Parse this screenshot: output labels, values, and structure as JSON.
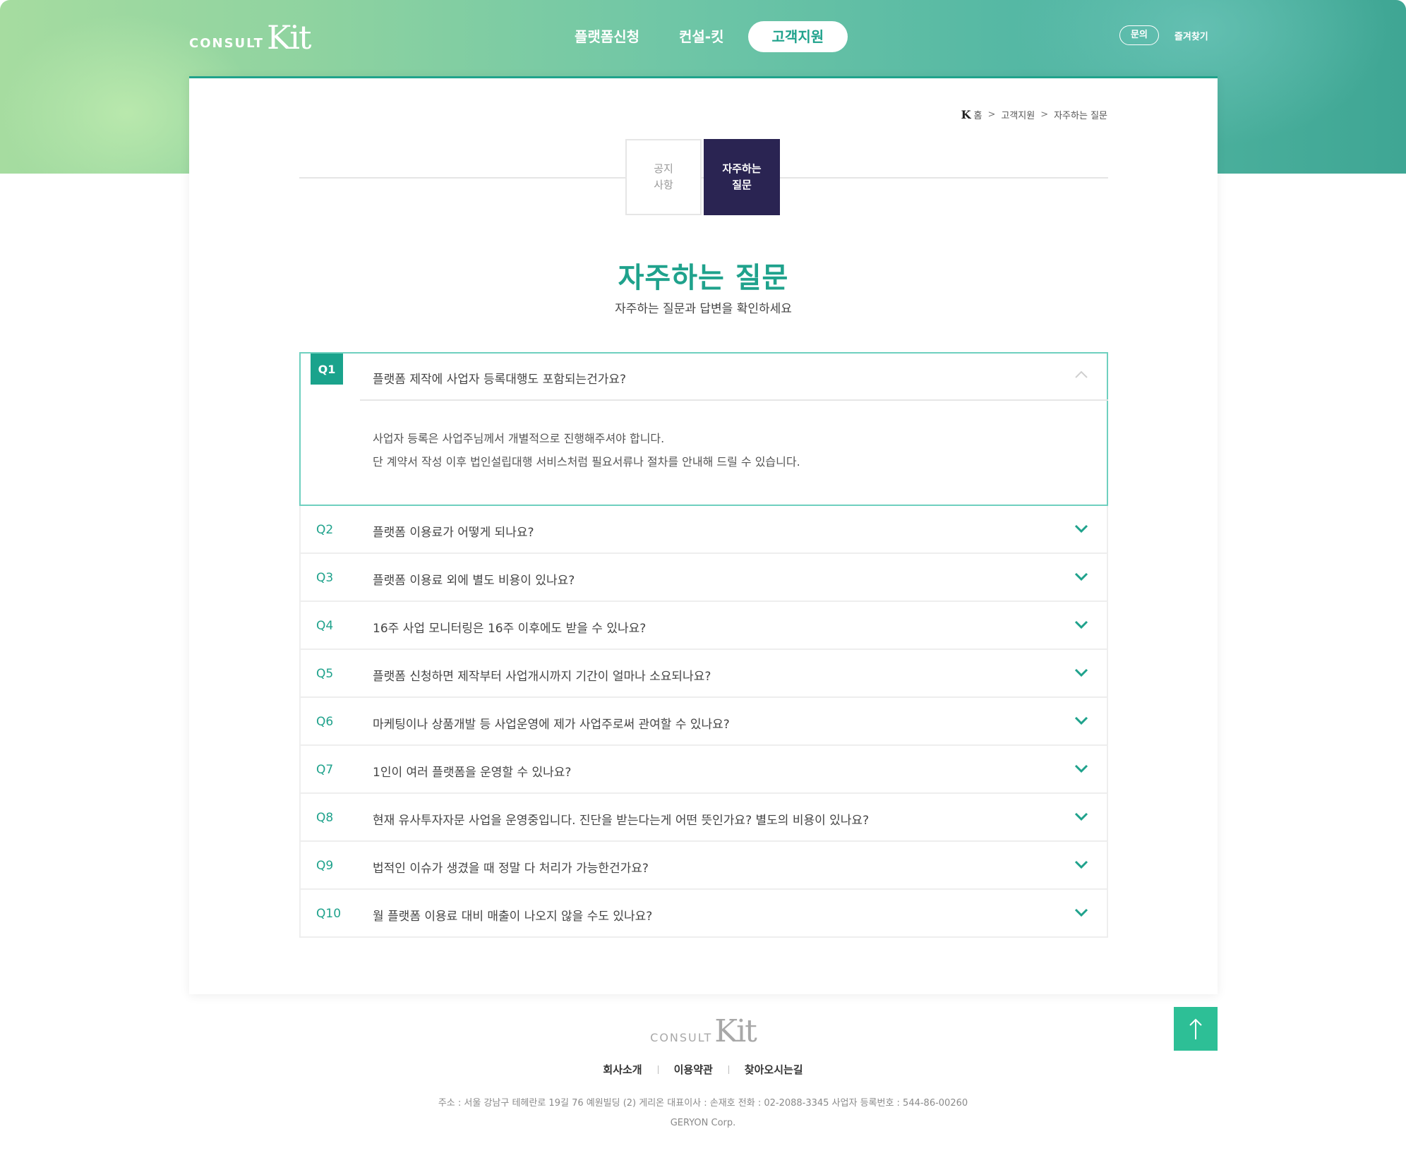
{
  "header": {
    "logo": {
      "consult": "CONSULT",
      "kit": "Kit"
    },
    "nav": [
      {
        "label": "플랫폼신청"
      },
      {
        "label": "컨설-킷"
      },
      {
        "label": "고객지원"
      }
    ],
    "util": {
      "inquiry": "문의",
      "favorites": "즐겨찾기"
    }
  },
  "breadcrumb": {
    "mark": "K",
    "items": [
      "홈",
      "고객지원",
      "자주하는 질문"
    ],
    "separator": ">"
  },
  "tabs": [
    {
      "label": "공지\n사항",
      "active": false
    },
    {
      "label": "자주하는\n질문",
      "active": true
    }
  ],
  "page": {
    "title": "자주하는 질문",
    "subtitle": "자주하는 질문과 답변을 확인하세요"
  },
  "faq": [
    {
      "num": "Q1",
      "question": "플랫폼 제작에 사업자 등록대행도 포함되는건가요?",
      "open": true,
      "answer": [
        "사업자 등록은 사업주님께서 개별적으로 진행해주셔야 합니다.",
        "단 계약서 작성 이후 법인설립대행 서비스처럼 필요서류나 절차를 안내해 드릴 수 있습니다."
      ]
    },
    {
      "num": "Q2",
      "question": "플랫폼 이용료가 어떻게 되나요?",
      "open": false
    },
    {
      "num": "Q3",
      "question": "플랫폼 이용료 외에 별도 비용이 있나요?",
      "open": false
    },
    {
      "num": "Q4",
      "question": "16주 사업 모니터링은 16주 이후에도 받을 수 있나요?",
      "open": false
    },
    {
      "num": "Q5",
      "question": "플랫폼 신청하면 제작부터 사업개시까지 기간이 얼마나 소요되나요?",
      "open": false
    },
    {
      "num": "Q6",
      "question": "마케팅이나 상품개발 등 사업운영에 제가 사업주로써 관여할 수 있나요?",
      "open": false
    },
    {
      "num": "Q7",
      "question": "1인이 여러 플랫폼을 운영할 수 있나요?",
      "open": false
    },
    {
      "num": "Q8",
      "question": "현재 유사투자자문 사업을 운영중입니다. 진단을 받는다는게 어떤 뜻인가요? 별도의 비용이 있나요?",
      "open": false
    },
    {
      "num": "Q9",
      "question": "법적인 이슈가 생겼을 때 정말 다 처리가 가능한건가요?",
      "open": false
    },
    {
      "num": "Q10",
      "question": "월 플랫폼 이용료 대비 매출이 나오지 않을 수도 있나요?",
      "open": false
    }
  ],
  "footer": {
    "logo": {
      "consult": "CONSULT",
      "kit": "Kit"
    },
    "links": [
      "회사소개",
      "이용약관",
      "찾아오시는길"
    ],
    "info": "주소 : 서울 강남구 테헤란로 19길 76 예원빌딩 (2) 게리온    대표이사 : 손재호    전화 : 02-2088-3345    사업자 등록번호 : 544-86-00260",
    "corp": "GERYON Corp."
  },
  "colors": {
    "accent": "#1fa28c",
    "tab_active_bg": "#2a2452",
    "top_button": "#2dbf96",
    "open_border": "#6fd0bf"
  },
  "icons": {
    "chevron_down": "chevron-down-icon",
    "chevron_up": "chevron-up-icon",
    "arrow_up": "arrow-up-icon"
  }
}
